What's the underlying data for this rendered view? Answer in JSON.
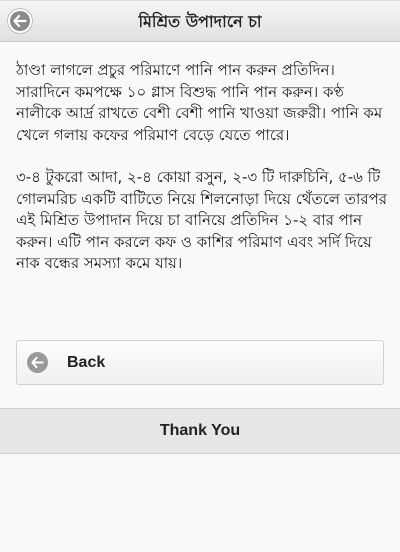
{
  "header": {
    "title": "মিশ্রিত উপাদানে চা",
    "back_icon": "arrow-left-circle-icon"
  },
  "content": {
    "paragraphs": [
      "ঠাণ্ডা লাগলে প্রচুর পরিমাণে পানি পান করুন প্রতিদিন। সারাদিনে কমপক্ষে ১০ গ্লাস বিশুদ্ধ পানি পান করুন। কণ্ঠ নালীকে আর্দ্র রাখতে বেশী বেশী পানি খাওয়া জরুরী। পানি কম খেলে গলায় কফের পরিমাণ বেড়ে যেতে পারে।",
      "৩-৪ টুকরো আদা, ২-৪ কোয়া রসুন, ২-৩ টি দারুচিনি, ৫-৬ টি গোলমরিচ একটি বাটিতে নিয়ে শিলনোড়া দিয়ে থেঁতলে তারপর এই মিশ্রিত উপাদান দিয়ে চা বানিয়ে প্রতিদিন ১-২ বার পান করুন। এটি পান করলে কফ ও কাশির পরিমাণ এবং সর্দি দিয়ে নাক বন্ধের সমস্যা কমে যায়।"
    ]
  },
  "back_button": {
    "label": "Back",
    "icon": "arrow-left-circle-icon"
  },
  "footer": {
    "label": "Thank You"
  }
}
